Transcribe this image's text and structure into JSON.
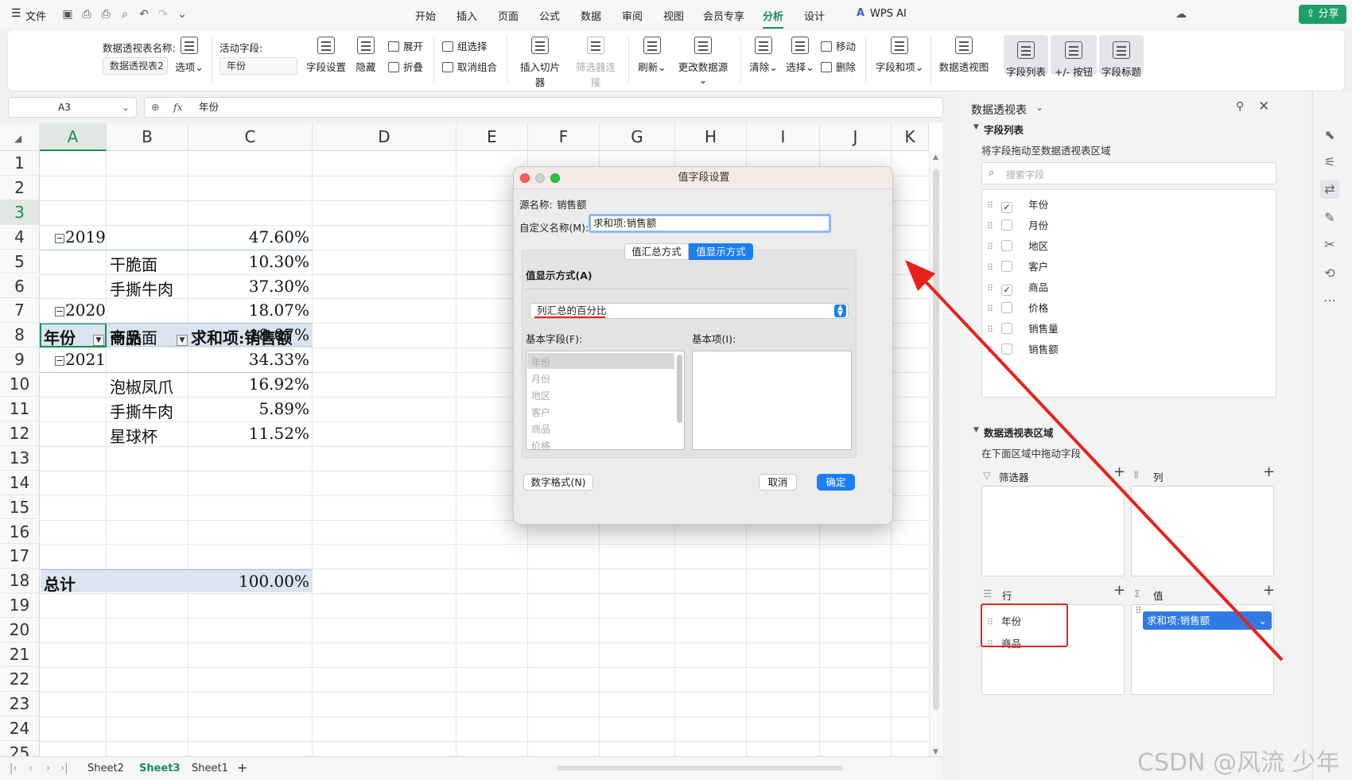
{
  "menubar": {
    "file": "文件",
    "tabs": [
      "开始",
      "插入",
      "页面",
      "公式",
      "数据",
      "审阅",
      "视图",
      "会员专享",
      "分析",
      "设计"
    ],
    "active_tab": "分析",
    "wps_ai": "WPS AI",
    "share": "分享"
  },
  "ribbon": {
    "pivot_name_label": "数据透视表名称:",
    "pivot_name_value": "数据透视表2",
    "options": "选项",
    "active_field_label": "活动字段:",
    "active_field_value": "年份",
    "field_settings": "字段设置",
    "hide": "隐藏",
    "expand": "展开",
    "collapse": "折叠",
    "group_select": "组选择",
    "ungroup": "取消组合",
    "insert_slicer": "插入切片器",
    "filter_connection": "筛选器连接",
    "refresh": "刷新",
    "change_source": "更改数据源",
    "clear": "清除",
    "select": "选择",
    "move": "移动",
    "delete": "删除",
    "fields_items": "字段和项",
    "pivot_chart": "数据透视图",
    "field_list": "字段列表",
    "plus_minus_buttons": "+/- 按钮",
    "field_headers": "字段标题"
  },
  "formula": {
    "cell_ref": "A3",
    "fx": "fx",
    "content": "年份"
  },
  "sheet": {
    "columns": [
      "A",
      "B",
      "C",
      "D",
      "E",
      "F",
      "G",
      "H",
      "I",
      "J",
      "K"
    ],
    "rows": [
      "1",
      "2",
      "3",
      "4",
      "5",
      "6",
      "7",
      "8",
      "9",
      "10",
      "11",
      "12",
      "13",
      "14",
      "15",
      "16",
      "17",
      "18",
      "19",
      "20",
      "21",
      "22",
      "23",
      "24",
      "25"
    ],
    "header": {
      "a": "年份",
      "b": "商品",
      "c": "求和项:销售额"
    },
    "data": [
      {
        "a": "2019",
        "b": "",
        "c": "47.60%",
        "year": true
      },
      {
        "a": "",
        "b": "干脆面",
        "c": "10.30%"
      },
      {
        "a": "",
        "b": "手撕牛肉",
        "c": "37.30%"
      },
      {
        "a": "2020",
        "b": "",
        "c": "18.07%",
        "year": true
      },
      {
        "a": "",
        "b": "干脆面",
        "c": "18.07%"
      },
      {
        "a": "2021",
        "b": "",
        "c": "34.33%",
        "year": true
      },
      {
        "a": "",
        "b": "泡椒凤爪",
        "c": "16.92%"
      },
      {
        "a": "",
        "b": "手撕牛肉",
        "c": "5.89%"
      },
      {
        "a": "",
        "b": "星球杯",
        "c": "11.52%"
      }
    ],
    "total": {
      "a": "总计",
      "c": "100.00%"
    }
  },
  "sheet_tabs": [
    "Sheet2",
    "Sheet3",
    "Sheet1"
  ],
  "active_sheet": "Sheet3",
  "dialog": {
    "title": "值字段设置",
    "source_label": "源名称:",
    "source_value": "销售额",
    "custom_name_label": "自定义名称(M):",
    "custom_name_value": "求和项:销售额",
    "tab_summarize": "值汇总方式",
    "tab_show_as": "值显示方式",
    "show_as_label": "值显示方式(A)",
    "show_as_value": "列汇总的百分比",
    "base_field_label": "基本字段(F):",
    "base_item_label": "基本项(I):",
    "base_fields": [
      "年份",
      "月份",
      "地区",
      "客户",
      "商品",
      "价格"
    ],
    "number_format": "数字格式(N)",
    "cancel": "取消",
    "ok": "确定"
  },
  "panel": {
    "title": "数据透视表",
    "field_list_title": "字段列表",
    "drag_hint": "将字段拖动至数据透视表区域",
    "search_placeholder": "搜索字段",
    "fields": [
      {
        "name": "年份",
        "checked": true
      },
      {
        "name": "月份",
        "checked": false
      },
      {
        "name": "地区",
        "checked": false
      },
      {
        "name": "客户",
        "checked": false
      },
      {
        "name": "商品",
        "checked": true
      },
      {
        "name": "价格",
        "checked": false
      },
      {
        "name": "销售量",
        "checked": false
      },
      {
        "name": "销售额",
        "checked": false
      }
    ],
    "areas_title": "数据透视表区域",
    "areas_hint": "在下面区域中拖动字段",
    "filter": "筛选器",
    "columns": "列",
    "rows": "行",
    "values": "值",
    "row_items": [
      "年份",
      "商品"
    ],
    "value_items": [
      "求和项:销售额"
    ]
  },
  "watermark": "CSDN @风流 少年",
  "colors": {
    "accent": "#1a8c5a",
    "annotation": "#e8221b",
    "primary_button": "#1a7ff5"
  }
}
